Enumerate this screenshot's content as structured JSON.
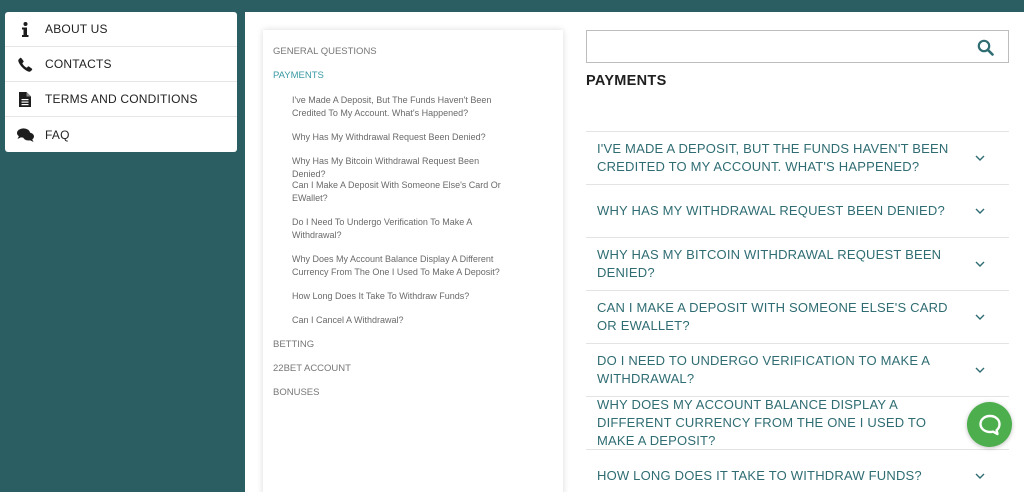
{
  "menu": {
    "items": [
      {
        "label": "ABOUT US",
        "icon": "info-icon"
      },
      {
        "label": "CONTACTS",
        "icon": "phone-icon"
      },
      {
        "label": "TERMS AND CONDITIONS",
        "icon": "document-icon"
      },
      {
        "label": "FAQ",
        "icon": "chat-bubbles-icon"
      }
    ]
  },
  "nav": {
    "general": "GENERAL QUESTIONS",
    "payments": "PAYMENTS",
    "questions": [
      "I've Made A Deposit, But The Funds Haven't Been Credited To My Account. What's Happened?",
      "Why Has My Withdrawal Request Been Denied?",
      "Why Has My Bitcoin Withdrawal Request Been Denied?",
      "Can I Make A Deposit With Someone Else's Card Or EWallet?",
      "Do I Need To Undergo Verification To Make A Withdrawal?",
      "Why Does My Account Balance Display A Different Currency From The One I Used To Make A Deposit?",
      "How Long Does It Take To Withdraw Funds?",
      "Can I Cancel A Withdrawal?"
    ],
    "betting": "BETTING",
    "account": "22BET ACCOUNT",
    "bonuses": "BONUSES"
  },
  "search": {
    "value": "",
    "placeholder": ""
  },
  "section_title": "PAYMENTS",
  "faq": [
    "I've made a deposit, but the funds haven't been credited to my account. What's happened?",
    "Why has my withdrawal request been denied?",
    "Why has my Bitcoin withdrawal request been denied?",
    "Can I make a deposit with someone else's card or eWallet?",
    "Do I need to undergo verification to make a withdrawal?",
    "Why does my account balance display a different currency from the one I used to make a deposit?",
    "How long does it take to withdraw funds?"
  ],
  "colors": {
    "background": "#2b5e63",
    "accent": "#3a9aa3",
    "faq_text": "#2f6d73",
    "chat": "#4cae4c"
  }
}
